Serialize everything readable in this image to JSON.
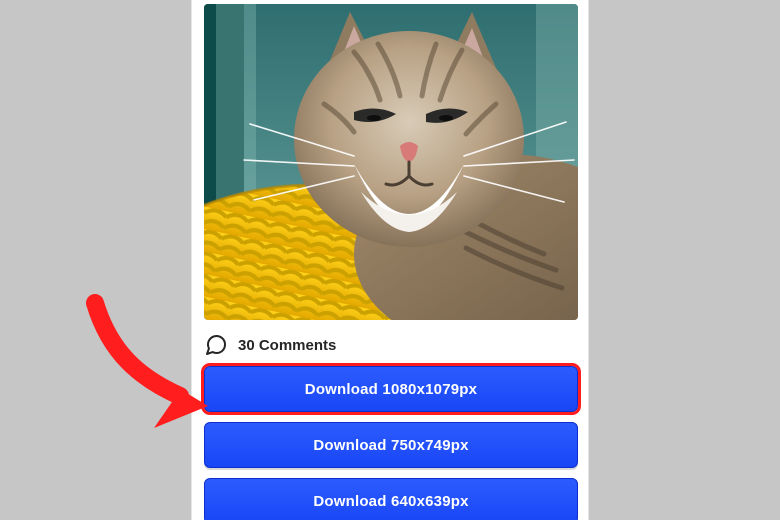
{
  "comments": {
    "count_text": "30 Comments"
  },
  "download_buttons": [
    {
      "label": "Download 1080x1079px",
      "highlighted": true
    },
    {
      "label": "Download 750x749px",
      "highlighted": false
    },
    {
      "label": "Download 640x639px",
      "highlighted": false
    }
  ],
  "annotation": {
    "type": "arrow",
    "color": "#ff1d1d"
  }
}
